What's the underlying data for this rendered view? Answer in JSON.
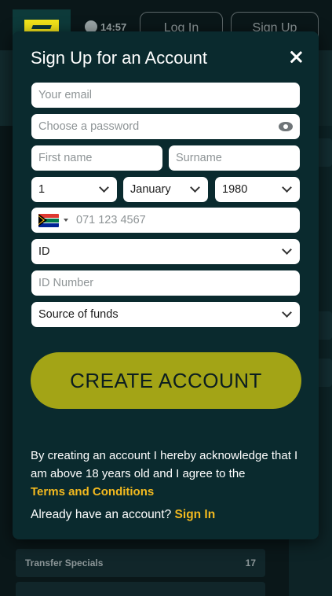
{
  "background": {
    "clock_time": "14:57",
    "login_label": "Log In",
    "signup_label": "Sign Up",
    "list_row_label": "Transfer Specials",
    "list_row_count": "17"
  },
  "modal": {
    "title": "Sign Up for an Account",
    "email_placeholder": "Your email",
    "password_placeholder": "Choose a password",
    "first_name_placeholder": "First name",
    "surname_placeholder": "Surname",
    "dob_day": "1",
    "dob_month": "January",
    "dob_year": "1980",
    "phone_placeholder": "071 123 4567",
    "id_type": "ID",
    "id_number_placeholder": "ID Number",
    "source_of_funds": "Source of funds",
    "create_label": "CREATE ACCOUNT",
    "terms_prefix": "By creating an account I hereby acknowledge that I am above 18 years old and I agree to the",
    "terms_link": "Terms and Conditions",
    "already_text": "Already have an account?",
    "sign_in_link": "Sign In"
  },
  "colors": {
    "accent_button": "#a3a416",
    "link": "#f2b91f",
    "modal_bg": "#0a2a2e"
  }
}
